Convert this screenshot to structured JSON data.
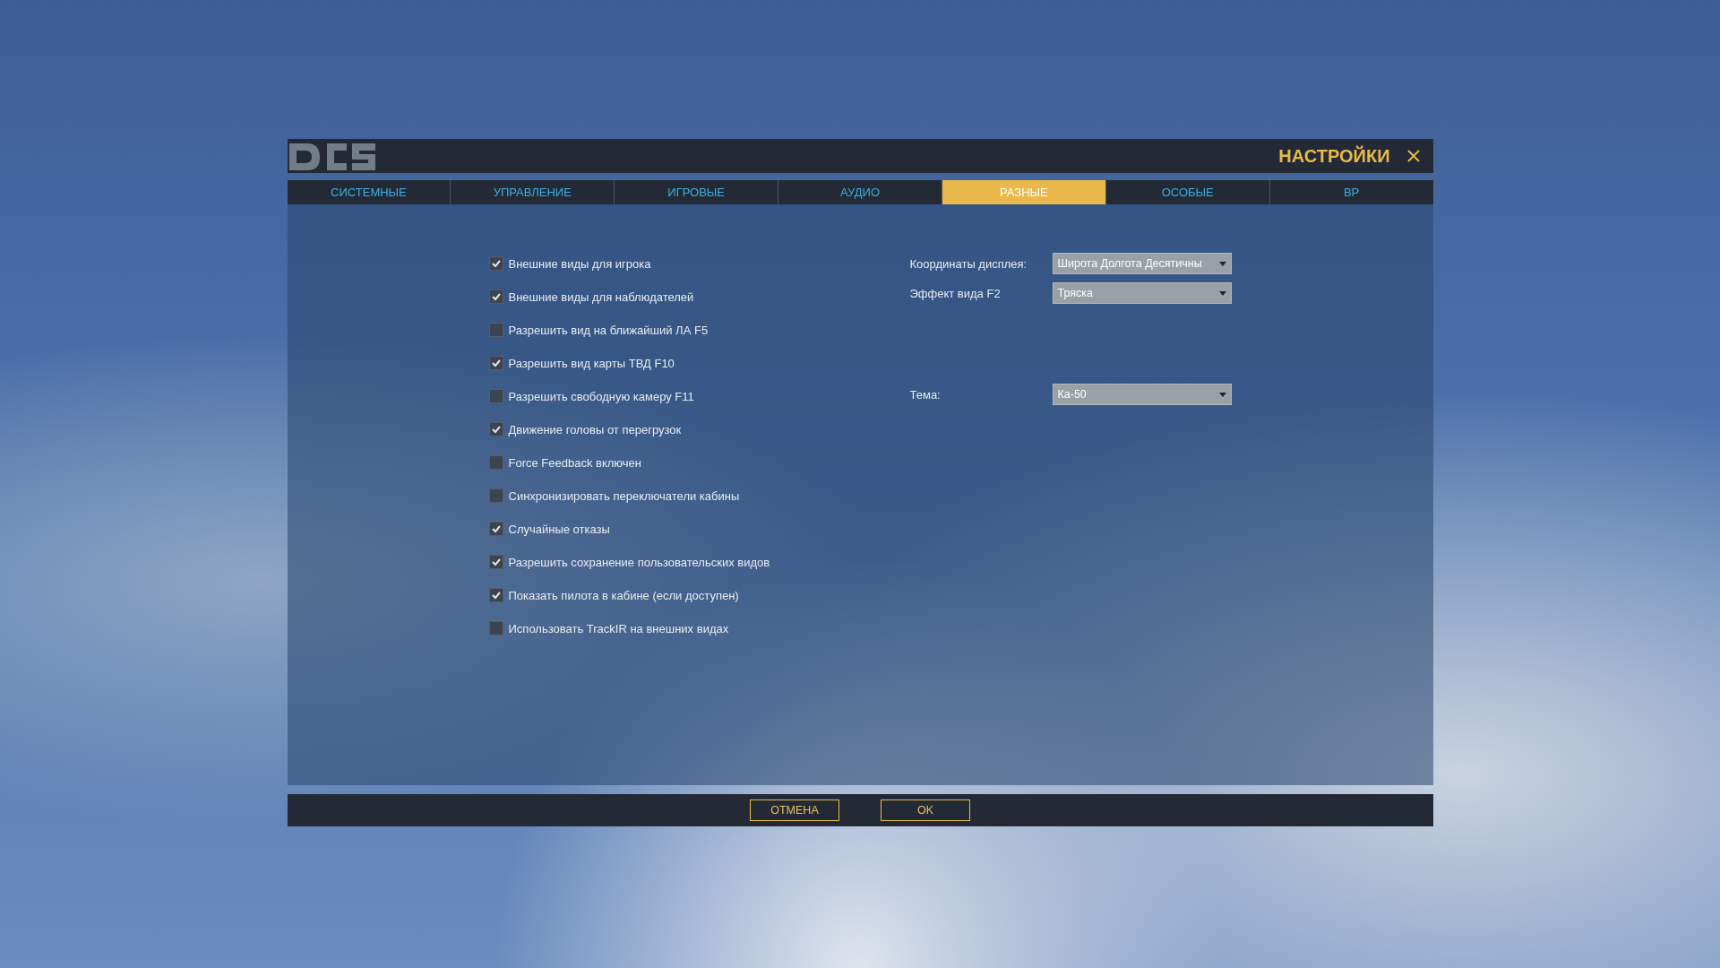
{
  "window": {
    "title": "НАСТРОЙКИ"
  },
  "tabs": [
    {
      "label": "СИСТЕМНЫЕ",
      "selected": false
    },
    {
      "label": "УПРАВЛЕНИЕ",
      "selected": false
    },
    {
      "label": "ИГРОВЫЕ",
      "selected": false
    },
    {
      "label": "АУДИО",
      "selected": false
    },
    {
      "label": "РАЗНЫЕ",
      "selected": true
    },
    {
      "label": "ОСОБЫЕ",
      "selected": false
    },
    {
      "label": "ВР",
      "selected": false
    }
  ],
  "options": [
    {
      "label": "Внешние виды для игрока",
      "checked": true
    },
    {
      "label": "Внешние виды для наблюдателей",
      "checked": true
    },
    {
      "label": "Разрешить вид на ближайший ЛА F5",
      "checked": false
    },
    {
      "label": "Разрешить вид карты ТВД F10",
      "checked": true
    },
    {
      "label": "Разрешить свободную камеру F11",
      "checked": false
    },
    {
      "label": "Движение головы от перегрузок",
      "checked": true
    },
    {
      "label": "Force Feedback включен",
      "checked": false
    },
    {
      "label": "Синхронизировать переключатели кабины",
      "checked": false
    },
    {
      "label": "Случайные отказы",
      "checked": true
    },
    {
      "label": "Разрешить сохранение пользовательских видов",
      "checked": true
    },
    {
      "label": "Показать пилота в кабине (если доступен)",
      "checked": true
    },
    {
      "label": "Использовать TrackIR на внешних видах",
      "checked": false
    }
  ],
  "dropdowns": [
    {
      "label": "Координаты дисплея:",
      "value": "Широта Долгота Десятичны"
    },
    {
      "label": "Эффект вида F2",
      "value": "Тряска"
    },
    {
      "label": "Тема:",
      "value": "Ка-50"
    }
  ],
  "buttons": [
    {
      "label": "ОТМЕНА"
    },
    {
      "label": "OK"
    }
  ]
}
